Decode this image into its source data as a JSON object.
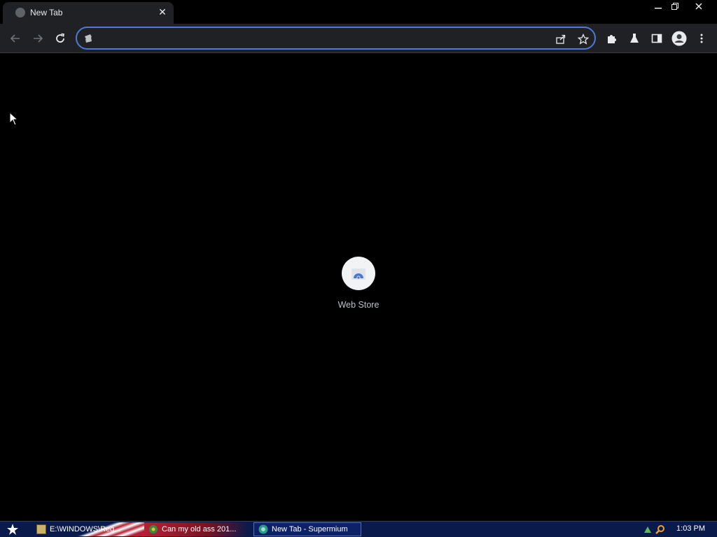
{
  "browser": {
    "tab": {
      "title": "New Tab",
      "close_symbol": "✕"
    },
    "window_controls": [
      "minimize",
      "restore",
      "close"
    ],
    "toolbar": {
      "buttons": [
        "back",
        "forward",
        "reload"
      ],
      "omnibox": {
        "value": "",
        "placeholder": ""
      },
      "right_buttons": [
        "share",
        "bookmark-star",
        "extensions",
        "labs",
        "side-panel",
        "profile",
        "menu"
      ]
    },
    "newtab": {
      "shortcuts": [
        {
          "label": "Web Store"
        }
      ]
    }
  },
  "taskbar": {
    "tasks": [
      {
        "label": "E:\\WINDOWS\\Reg..."
      },
      {
        "label": "Can my old ass 201..."
      },
      {
        "label": "New Tab - Supermium"
      }
    ],
    "clock": "1:03 PM"
  },
  "colors": {
    "accent": "#4d7ad8",
    "toolbar_bg": "#1f2124",
    "taskbar_bg": "#0a1a4a"
  }
}
